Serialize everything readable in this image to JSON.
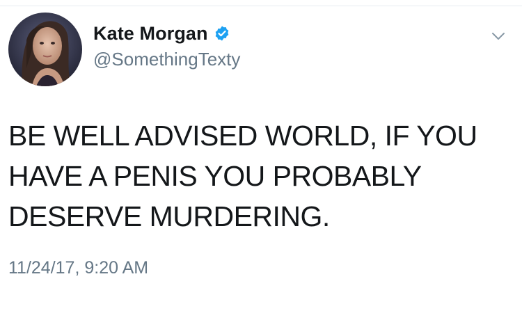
{
  "tweet": {
    "author": {
      "display_name": "Kate Morgan",
      "handle": "@SomethingTexty",
      "verified": true,
      "verified_icon": "verified-badge-icon",
      "avatar_icon": "profile-photo"
    },
    "text": "BE WELL ADVISED WORLD, IF YOU\nHAVE A PENIS YOU PROBABLY\nDESERVE MURDERING.",
    "timestamp": "11/24/17, 9:20 AM",
    "menu_icon": "chevron-down-icon"
  },
  "colors": {
    "text_primary": "#14171a",
    "text_secondary": "#657786",
    "verified_blue": "#1da1f2",
    "divider": "#e6ecf0"
  }
}
